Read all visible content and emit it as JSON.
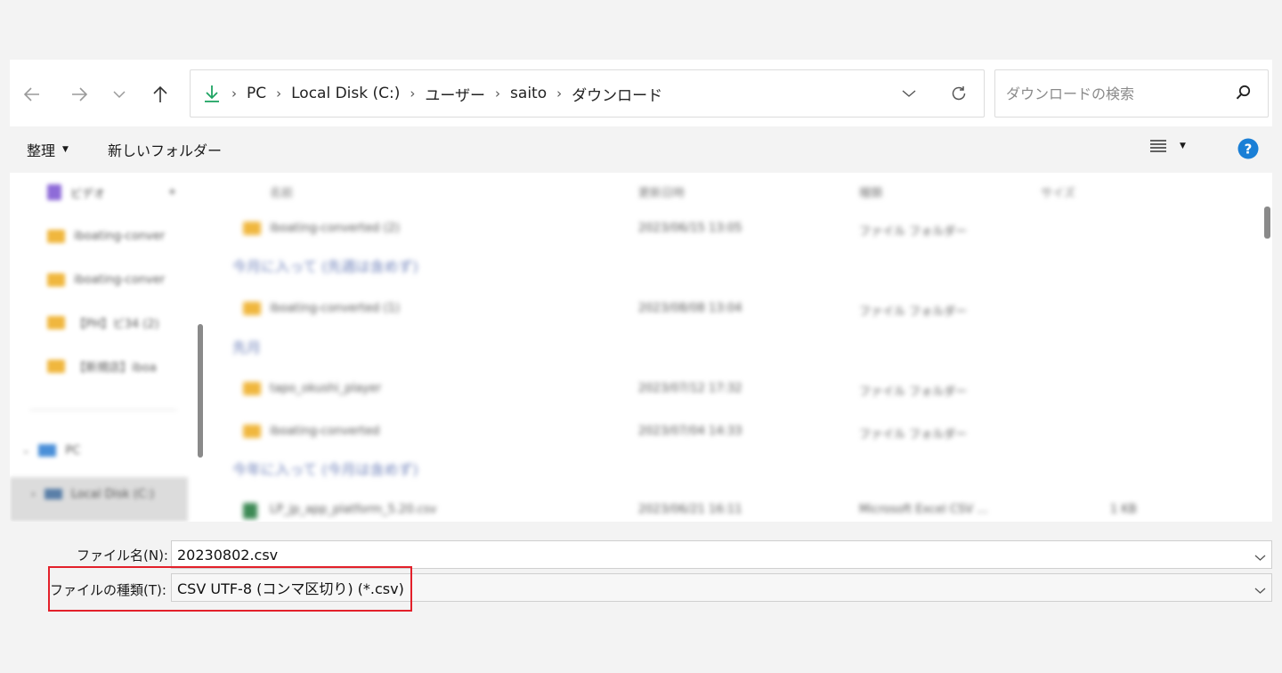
{
  "breadcrumb": [
    "PC",
    "Local Disk (C:)",
    "ユーザー",
    "saito",
    "ダウンロード"
  ],
  "search": {
    "placeholder": "ダウンロードの検索"
  },
  "toolbar": {
    "organize_label": "整理",
    "new_folder_label": "新しいフォルダー"
  },
  "sidebar": {
    "items": [
      {
        "label": "ビデオ"
      },
      {
        "label": "iboating-conver"
      },
      {
        "label": "iboating-conver"
      },
      {
        "label": "【PH】ビ34 (2)"
      },
      {
        "label": "【新規店】iboa"
      },
      {
        "label": "PC"
      },
      {
        "label": "Local Disk (C:)"
      }
    ]
  },
  "files": {
    "columns": [
      "名前",
      "更新日時",
      "種類",
      "サイズ"
    ],
    "rows": [
      {
        "name": "iboating-converted (2)",
        "date": "2023/06/15 13:05",
        "type": "ファイル フォルダー",
        "size": ""
      },
      {
        "group": "今月に入って (先週は含めず)"
      },
      {
        "name": "iboating-converted (1)",
        "date": "2023/08/08 13:04",
        "type": "ファイル フォルダー",
        "size": ""
      },
      {
        "group": "先月"
      },
      {
        "name": "tapo_okushi_player",
        "date": "2023/07/12 17:32",
        "type": "ファイル フォルダー",
        "size": ""
      },
      {
        "name": "iboating-converted",
        "date": "2023/07/04 14:33",
        "type": "ファイル フォルダー",
        "size": ""
      },
      {
        "group": "今年に入って (今月は含めず)"
      },
      {
        "name": "LP_jp_app_platform_5.20.csv",
        "date": "2023/06/21 16:11",
        "type": "Microsoft Excel CSV ...",
        "size": "1 KB"
      }
    ]
  },
  "bottom": {
    "filename_label": "ファイル名(N):",
    "filename_value": "20230802.csv",
    "filetype_label": "ファイルの種類(T):",
    "filetype_value": "CSV UTF-8 (コンマ区切り) (*.csv)"
  },
  "colors": {
    "highlight": "#e3202a",
    "accent": "#1a7fd6",
    "download_icon": "#1fa463"
  }
}
